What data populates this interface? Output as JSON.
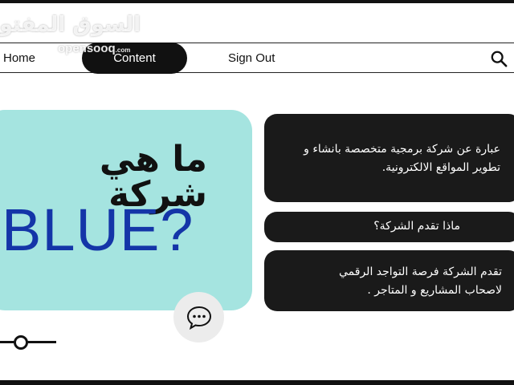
{
  "watermark": {
    "arabic": "السوق المفتوح",
    "latin": "opensooq",
    "suffix": ".com"
  },
  "nav": {
    "home": "Home",
    "content": "Content",
    "sign_out": "Sign Out",
    "search_icon": "search-icon"
  },
  "hero": {
    "arabic_title": "ما هي شركة",
    "english_title": "BLUE?",
    "background_color": "#a5e4e0",
    "title_color": "#1435a8"
  },
  "cards": [
    {
      "line1": "عبارة عن شركة برمجية متخصصة بانشاء و",
      "line2": "تطوير المواقع الالكترونية."
    },
    {
      "line1": "ماذا تقدم الشركة؟"
    },
    {
      "line1": "تقدم الشركة فرصة التواجد الرقمي",
      "line2": "لاصحاب المشاريع و المتاجر ."
    }
  ],
  "chat_icon": "chat-bubble-icon"
}
